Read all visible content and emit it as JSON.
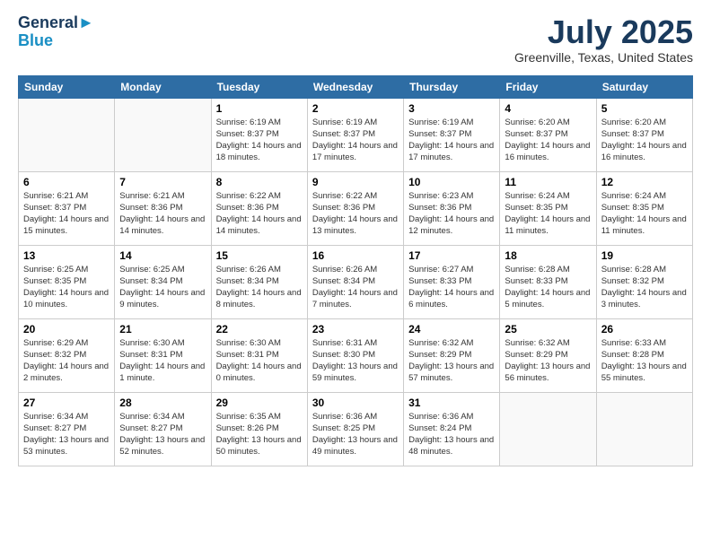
{
  "app": {
    "logo_line1": "General",
    "logo_line2": "Blue"
  },
  "header": {
    "title": "July 2025",
    "location": "Greenville, Texas, United States"
  },
  "weekdays": [
    "Sunday",
    "Monday",
    "Tuesday",
    "Wednesday",
    "Thursday",
    "Friday",
    "Saturday"
  ],
  "weeks": [
    [
      {
        "day": "",
        "sunrise": "",
        "sunset": "",
        "daylight": ""
      },
      {
        "day": "",
        "sunrise": "",
        "sunset": "",
        "daylight": ""
      },
      {
        "day": "1",
        "sunrise": "Sunrise: 6:19 AM",
        "sunset": "Sunset: 8:37 PM",
        "daylight": "Daylight: 14 hours and 18 minutes."
      },
      {
        "day": "2",
        "sunrise": "Sunrise: 6:19 AM",
        "sunset": "Sunset: 8:37 PM",
        "daylight": "Daylight: 14 hours and 17 minutes."
      },
      {
        "day": "3",
        "sunrise": "Sunrise: 6:19 AM",
        "sunset": "Sunset: 8:37 PM",
        "daylight": "Daylight: 14 hours and 17 minutes."
      },
      {
        "day": "4",
        "sunrise": "Sunrise: 6:20 AM",
        "sunset": "Sunset: 8:37 PM",
        "daylight": "Daylight: 14 hours and 16 minutes."
      },
      {
        "day": "5",
        "sunrise": "Sunrise: 6:20 AM",
        "sunset": "Sunset: 8:37 PM",
        "daylight": "Daylight: 14 hours and 16 minutes."
      }
    ],
    [
      {
        "day": "6",
        "sunrise": "Sunrise: 6:21 AM",
        "sunset": "Sunset: 8:37 PM",
        "daylight": "Daylight: 14 hours and 15 minutes."
      },
      {
        "day": "7",
        "sunrise": "Sunrise: 6:21 AM",
        "sunset": "Sunset: 8:36 PM",
        "daylight": "Daylight: 14 hours and 14 minutes."
      },
      {
        "day": "8",
        "sunrise": "Sunrise: 6:22 AM",
        "sunset": "Sunset: 8:36 PM",
        "daylight": "Daylight: 14 hours and 14 minutes."
      },
      {
        "day": "9",
        "sunrise": "Sunrise: 6:22 AM",
        "sunset": "Sunset: 8:36 PM",
        "daylight": "Daylight: 14 hours and 13 minutes."
      },
      {
        "day": "10",
        "sunrise": "Sunrise: 6:23 AM",
        "sunset": "Sunset: 8:36 PM",
        "daylight": "Daylight: 14 hours and 12 minutes."
      },
      {
        "day": "11",
        "sunrise": "Sunrise: 6:24 AM",
        "sunset": "Sunset: 8:35 PM",
        "daylight": "Daylight: 14 hours and 11 minutes."
      },
      {
        "day": "12",
        "sunrise": "Sunrise: 6:24 AM",
        "sunset": "Sunset: 8:35 PM",
        "daylight": "Daylight: 14 hours and 11 minutes."
      }
    ],
    [
      {
        "day": "13",
        "sunrise": "Sunrise: 6:25 AM",
        "sunset": "Sunset: 8:35 PM",
        "daylight": "Daylight: 14 hours and 10 minutes."
      },
      {
        "day": "14",
        "sunrise": "Sunrise: 6:25 AM",
        "sunset": "Sunset: 8:34 PM",
        "daylight": "Daylight: 14 hours and 9 minutes."
      },
      {
        "day": "15",
        "sunrise": "Sunrise: 6:26 AM",
        "sunset": "Sunset: 8:34 PM",
        "daylight": "Daylight: 14 hours and 8 minutes."
      },
      {
        "day": "16",
        "sunrise": "Sunrise: 6:26 AM",
        "sunset": "Sunset: 8:34 PM",
        "daylight": "Daylight: 14 hours and 7 minutes."
      },
      {
        "day": "17",
        "sunrise": "Sunrise: 6:27 AM",
        "sunset": "Sunset: 8:33 PM",
        "daylight": "Daylight: 14 hours and 6 minutes."
      },
      {
        "day": "18",
        "sunrise": "Sunrise: 6:28 AM",
        "sunset": "Sunset: 8:33 PM",
        "daylight": "Daylight: 14 hours and 5 minutes."
      },
      {
        "day": "19",
        "sunrise": "Sunrise: 6:28 AM",
        "sunset": "Sunset: 8:32 PM",
        "daylight": "Daylight: 14 hours and 3 minutes."
      }
    ],
    [
      {
        "day": "20",
        "sunrise": "Sunrise: 6:29 AM",
        "sunset": "Sunset: 8:32 PM",
        "daylight": "Daylight: 14 hours and 2 minutes."
      },
      {
        "day": "21",
        "sunrise": "Sunrise: 6:30 AM",
        "sunset": "Sunset: 8:31 PM",
        "daylight": "Daylight: 14 hours and 1 minute."
      },
      {
        "day": "22",
        "sunrise": "Sunrise: 6:30 AM",
        "sunset": "Sunset: 8:31 PM",
        "daylight": "Daylight: 14 hours and 0 minutes."
      },
      {
        "day": "23",
        "sunrise": "Sunrise: 6:31 AM",
        "sunset": "Sunset: 8:30 PM",
        "daylight": "Daylight: 13 hours and 59 minutes."
      },
      {
        "day": "24",
        "sunrise": "Sunrise: 6:32 AM",
        "sunset": "Sunset: 8:29 PM",
        "daylight": "Daylight: 13 hours and 57 minutes."
      },
      {
        "day": "25",
        "sunrise": "Sunrise: 6:32 AM",
        "sunset": "Sunset: 8:29 PM",
        "daylight": "Daylight: 13 hours and 56 minutes."
      },
      {
        "day": "26",
        "sunrise": "Sunrise: 6:33 AM",
        "sunset": "Sunset: 8:28 PM",
        "daylight": "Daylight: 13 hours and 55 minutes."
      }
    ],
    [
      {
        "day": "27",
        "sunrise": "Sunrise: 6:34 AM",
        "sunset": "Sunset: 8:27 PM",
        "daylight": "Daylight: 13 hours and 53 minutes."
      },
      {
        "day": "28",
        "sunrise": "Sunrise: 6:34 AM",
        "sunset": "Sunset: 8:27 PM",
        "daylight": "Daylight: 13 hours and 52 minutes."
      },
      {
        "day": "29",
        "sunrise": "Sunrise: 6:35 AM",
        "sunset": "Sunset: 8:26 PM",
        "daylight": "Daylight: 13 hours and 50 minutes."
      },
      {
        "day": "30",
        "sunrise": "Sunrise: 6:36 AM",
        "sunset": "Sunset: 8:25 PM",
        "daylight": "Daylight: 13 hours and 49 minutes."
      },
      {
        "day": "31",
        "sunrise": "Sunrise: 6:36 AM",
        "sunset": "Sunset: 8:24 PM",
        "daylight": "Daylight: 13 hours and 48 minutes."
      },
      {
        "day": "",
        "sunrise": "",
        "sunset": "",
        "daylight": ""
      },
      {
        "day": "",
        "sunrise": "",
        "sunset": "",
        "daylight": ""
      }
    ]
  ]
}
